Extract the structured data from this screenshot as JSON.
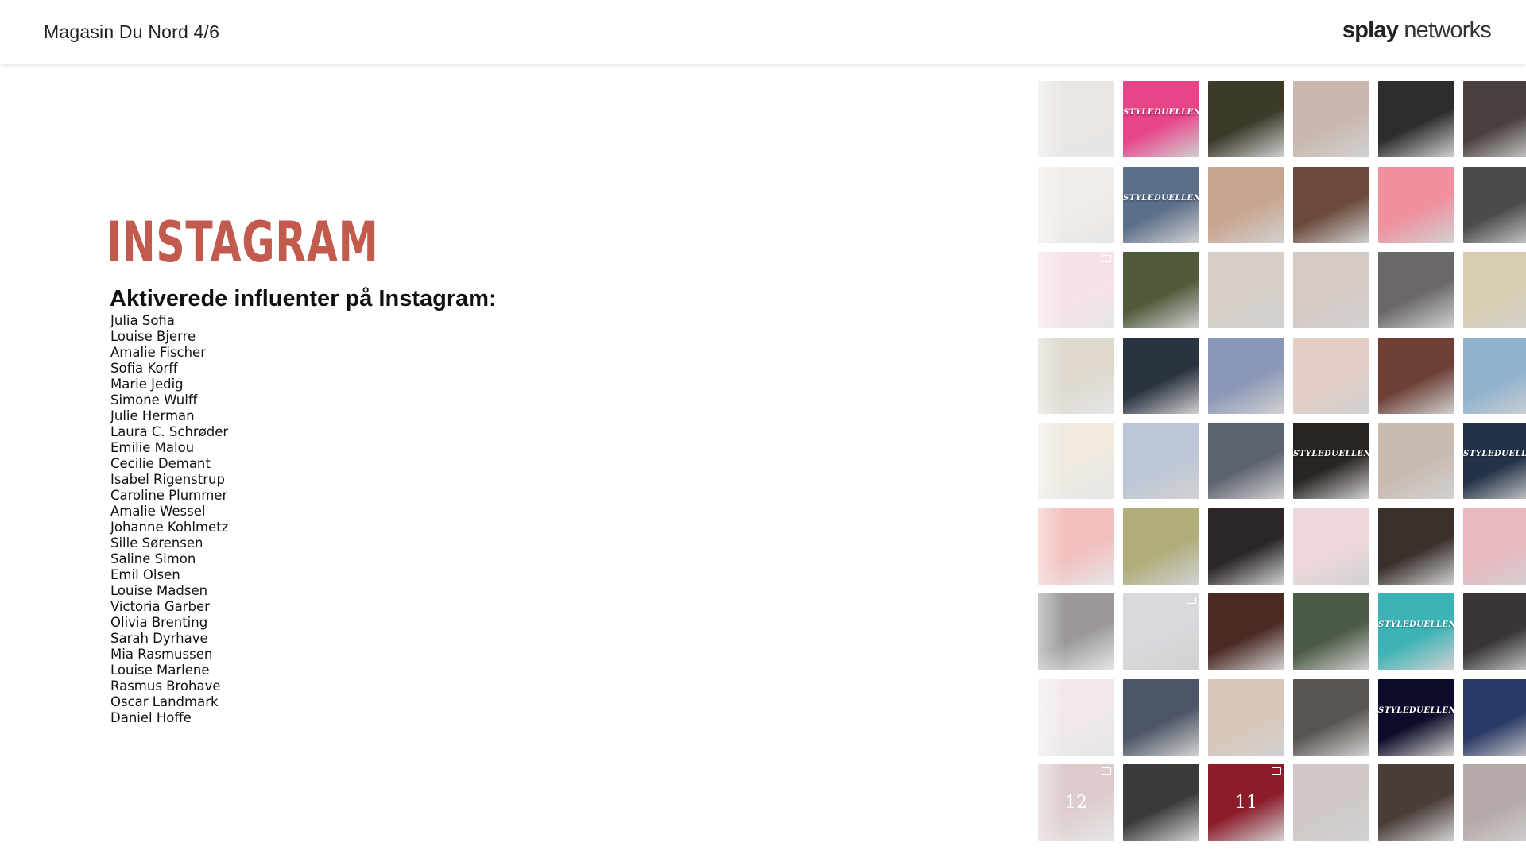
{
  "header": {
    "title": "Magasin Du Nord 4/6",
    "brand_bold": "splay",
    "brand_light": " networks"
  },
  "main": {
    "heading": "INSTAGRAM",
    "subtitle": "Aktiverede influenter på Instagram:",
    "influencers": [
      "Julia Sofia",
      "Louise Bjerre",
      "Amalie Fischer",
      "Sofia Korff",
      "Marie Jedig",
      "Simone Wulff",
      "Julie Herman",
      "Laura C. Schrøder",
      "Emilie Malou",
      "Cecilie Demant",
      "Isabel Rigenstrup",
      "Caroline Plummer",
      "Amalie Wessel",
      "Johanne Kohlmetz",
      "Sille Sørensen",
      "Saline Simon",
      "Emil Olsen",
      "Louise Madsen",
      "Victoria Garber",
      "Olivia Brenting",
      "Sarah Dyrhave",
      "Mia Rasmussen",
      "Louise Marlene",
      "Rasmus Brohave",
      "Oscar Landmark",
      "Daniel Hoffe"
    ]
  },
  "colors": {
    "heading": "#c25a4e",
    "tiles": [
      [
        "#d9d3cc",
        "#e8448a",
        "#3d3a2a",
        "#c9b7ad",
        "#2f2c2e",
        "#4a403d"
      ],
      [
        "#e6dcd4",
        "#5b6e8a",
        "#c9a58f",
        "#6b4a3b",
        "#f08f9d",
        "#4d4a4a"
      ],
      [
        "#f2c9d8",
        "#4f5a3a",
        "#d7cfc8",
        "#d5c9c4",
        "#6c6868",
        "#d8cdb0"
      ],
      [
        "#c2b8a6",
        "#2a3340",
        "#8b97b8",
        "#e3cdc5",
        "#6d3f35",
        "#8fb2cf"
      ],
      [
        "#e3d9c8",
        "#bcc6d6",
        "#5c6270",
        "#2a2422",
        "#c9bab0",
        "#233248"
      ],
      [
        "#e88a88",
        "#b0ad7a",
        "#2c2626",
        "#eed7da",
        "#3a302c",
        "#e7b8bf"
      ],
      [
        "#4a4444",
        "#d9d9dd",
        "#4c2a24",
        "#4c5b45",
        "#3cb3b6",
        "#3a3636"
      ],
      [
        "#e6d6d8",
        "#4d5667",
        "#d8c6b8",
        "#5a5450",
        "#0c0c2a",
        "#2a3a66"
      ],
      [
        "#c4a4a6",
        "#3a3a3a",
        "#8c1c2a",
        "#cfc8c6",
        "#4a3c38",
        "#b5aaa8"
      ]
    ],
    "icons": [
      [
        "",
        "",
        "",
        "",
        "",
        ""
      ],
      [
        "",
        "",
        "",
        "",
        "",
        ""
      ],
      [
        "video-icon",
        "",
        "",
        "",
        "",
        ""
      ],
      [
        "",
        "",
        "",
        "",
        "",
        ""
      ],
      [
        "",
        "",
        "",
        "",
        "",
        ""
      ],
      [
        "",
        "",
        "",
        "",
        "",
        ""
      ],
      [
        "",
        "video-icon",
        "",
        "",
        "",
        ""
      ],
      [
        "",
        "",
        "",
        "",
        "",
        ""
      ],
      [
        "video-icon",
        "",
        "video-icon",
        "",
        "",
        ""
      ]
    ]
  },
  "grid_overlays": {
    "r0c1": "STYLEDUELLEN",
    "r1c1": "STYLEDUELLEN",
    "r4c3": "STYLEDUELLEN",
    "r4c5": "STYLEDUELLEN",
    "r6c4": "STYLEDUELLEN",
    "r7c4": "STYLEDUELLEN",
    "r8c0": "12",
    "r8c2": "11"
  }
}
